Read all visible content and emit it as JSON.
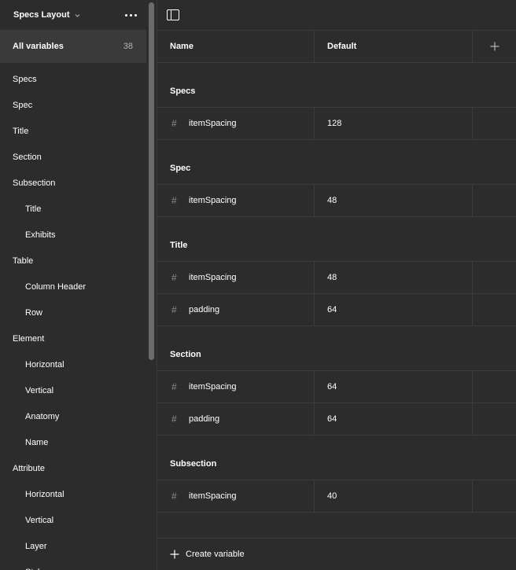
{
  "sidebar": {
    "title": "Specs Layout",
    "all_label": "All variables",
    "all_count": "38",
    "items": [
      {
        "label": "Specs",
        "child": false
      },
      {
        "label": "Spec",
        "child": false
      },
      {
        "label": "Title",
        "child": false
      },
      {
        "label": "Section",
        "child": false
      },
      {
        "label": "Subsection",
        "child": false
      },
      {
        "label": "Title",
        "child": true
      },
      {
        "label": "Exhibits",
        "child": true
      },
      {
        "label": "Table",
        "child": false
      },
      {
        "label": "Column Header",
        "child": true
      },
      {
        "label": "Row",
        "child": true
      },
      {
        "label": "Element",
        "child": false
      },
      {
        "label": "Horizontal",
        "child": true
      },
      {
        "label": "Vertical",
        "child": true
      },
      {
        "label": "Anatomy",
        "child": true
      },
      {
        "label": "Name",
        "child": true
      },
      {
        "label": "Attribute",
        "child": false
      },
      {
        "label": "Horizontal",
        "child": true
      },
      {
        "label": "Vertical",
        "child": true
      },
      {
        "label": "Layer",
        "child": true
      },
      {
        "label": "Style",
        "child": true
      }
    ]
  },
  "table": {
    "col_name": "Name",
    "col_default": "Default",
    "groups": [
      {
        "title": "Specs",
        "rows": [
          {
            "name": "itemSpacing",
            "value": "128"
          }
        ]
      },
      {
        "title": "Spec",
        "rows": [
          {
            "name": "itemSpacing",
            "value": "48"
          }
        ]
      },
      {
        "title": "Title",
        "rows": [
          {
            "name": "itemSpacing",
            "value": "48"
          },
          {
            "name": "padding",
            "value": "64"
          }
        ]
      },
      {
        "title": "Section",
        "rows": [
          {
            "name": "itemSpacing",
            "value": "64"
          },
          {
            "name": "padding",
            "value": "64"
          }
        ]
      },
      {
        "title": "Subsection",
        "rows": [
          {
            "name": "itemSpacing",
            "value": "40"
          }
        ]
      }
    ]
  },
  "footer": {
    "create_label": "Create variable"
  },
  "icons": {
    "hash": "#",
    "more": "more-horizontal-icon",
    "add": "plus-icon",
    "panel": "sidebar-toggle-icon"
  }
}
